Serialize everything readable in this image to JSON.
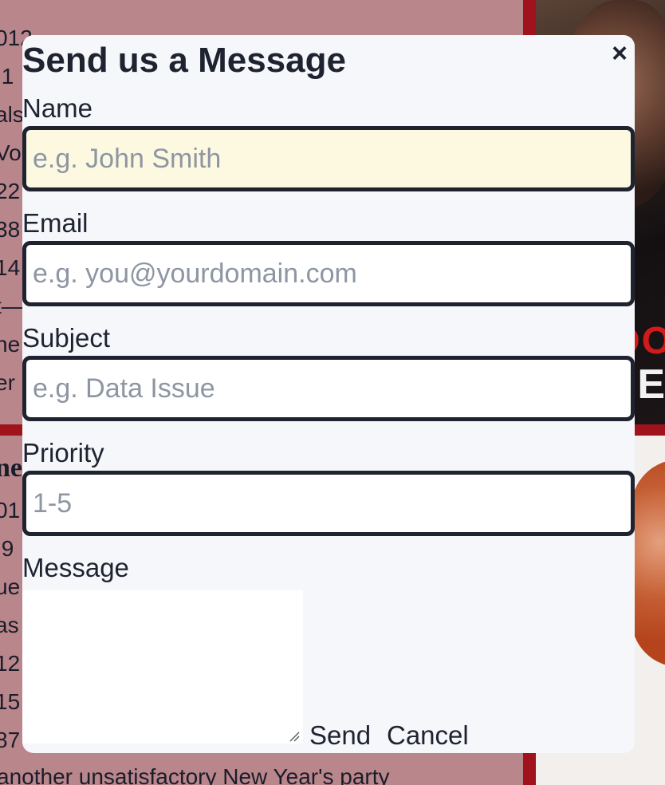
{
  "background": {
    "top_lines": [
      "012",
      ".1",
      "als",
      "Vo",
      "22",
      "38",
      "14",
      "t—",
      "he",
      "er"
    ],
    "bottom_heading": "ne",
    "bottom_lines": [
      "01",
      ".9",
      "ue",
      "as",
      "12",
      "15",
      "87"
    ],
    "footer_text": "another unsatisfactory New Year's party",
    "poster_top_text": "OO",
    "poster_top_text2": "E"
  },
  "modal": {
    "title": "Send us a Message",
    "close_label": "×",
    "fields": [
      {
        "label": "Name",
        "placeholder": "e.g. John Smith",
        "value": ""
      },
      {
        "label": "Email",
        "placeholder": "e.g. you@yourdomain.com",
        "value": ""
      },
      {
        "label": "Subject",
        "placeholder": "e.g. Data Issue",
        "value": ""
      },
      {
        "label": "Priority",
        "placeholder": "1-5",
        "value": ""
      }
    ],
    "message_label": "Message",
    "message_value": "",
    "send_label": "Send",
    "cancel_label": "Cancel"
  },
  "colors": {
    "modal_bg": "#f6f7fb",
    "text": "#1f2330",
    "input_border": "#1f2330",
    "autofill_bg": "#fdf9e1",
    "placeholder": "#8e96a3",
    "accent_red": "#a0121c"
  },
  "icons": {
    "close": "close-icon",
    "resize": "resize-grip-icon"
  }
}
